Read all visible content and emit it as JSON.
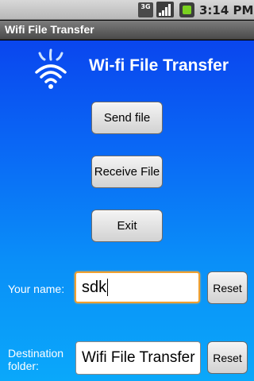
{
  "status_bar": {
    "network_type": "3G",
    "time": "3:14 PM"
  },
  "title_bar": {
    "title": "Wifi File Transfer"
  },
  "header": {
    "app_title": "Wi-fi File Transfer",
    "logo_icon": "wifi-logo-icon"
  },
  "actions": {
    "send_file": "Send file",
    "receive_file": "Receive File",
    "exit": "Exit"
  },
  "form": {
    "name_label": "Your name:",
    "name_value": "sdk",
    "name_reset": "Reset",
    "dest_label": "Destination folder:",
    "dest_value": "Wifi File Transfer",
    "dest_reset": "Reset"
  },
  "colors": {
    "background_top": "#0a46ee",
    "background_bottom": "#0aa8fa",
    "focus_border": "#f0a030"
  }
}
